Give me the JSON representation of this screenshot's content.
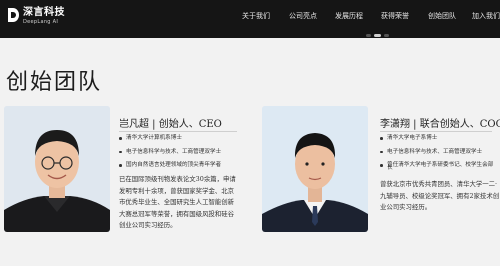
{
  "brand": {
    "name_cn": "深言科技",
    "name_en": "DeepLang AI"
  },
  "nav": [
    "关于我们",
    "公司亮点",
    "发展历程",
    "获得荣誉",
    "创始团队",
    "加入我们"
  ],
  "section": {
    "title": "创始团队"
  },
  "members": [
    {
      "name": "岂凡超 | 创始人、CEO",
      "bullets": [
        "清华大学计算机系博士",
        "电子信息科学与技术、工商管理双学士",
        "国内自然语言处理领域的顶尖青年学者"
      ],
      "bio": [
        "已在国际顶级刊物发表论文30余篇，申请",
        "发明专利十余项，曾获国家奖学金、北京",
        "市优秀毕业生、全国研究生人工智能创新",
        "大赛总冠军等荣誉，拥有国级风投和硅谷",
        "创业公司实习经历。"
      ]
    },
    {
      "name": "李潇翔 | 联合创始人、COO",
      "bullets": [
        "清华大学电子系博士",
        "电子信息科学与技术、工商管理双学士",
        "曾任清华大学电子系研委书记、校学生会部",
        "长"
      ],
      "bio": [
        "曾获北京市优秀共青团员、清华大学一二·",
        "九辅导员、校级论奖冠军、拥有2家技术创",
        "业公司实习经历。"
      ]
    }
  ]
}
